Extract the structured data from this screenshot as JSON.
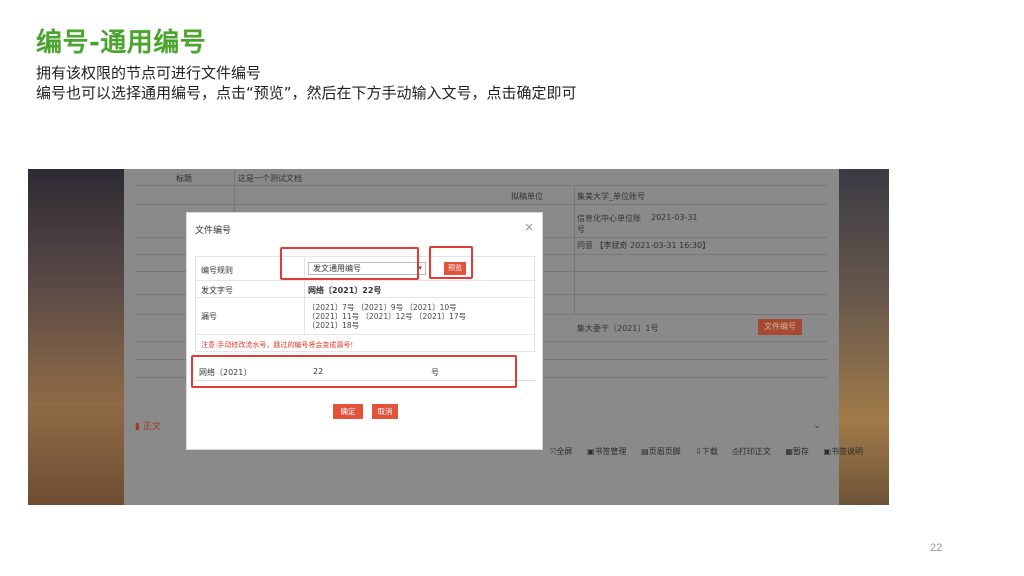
{
  "slide": {
    "title": "编号-通用编号",
    "line1": "拥有该权限的节点可进行文件编号",
    "line2": "编号也可以选择通用编号，点击“预览”，然后在下方手动输入文号，点击确定即可",
    "page_number": "22"
  },
  "background_form": {
    "title_label": "标题",
    "title_value": "这是一个测试文档",
    "draft_unit_label": "拟稿单位",
    "draft_unit_value": "集美大学_单位账号",
    "sign_label": "签",
    "info_center": "信息化中心单位账号",
    "info_date": "2021-03-31",
    "approve_label": "稿",
    "approve_value": "同意 【李斌奇  2021-03-31 16:30】",
    "receive_label": "集大委干〔2021〕1号",
    "file_number_btn": "文件编号",
    "zhengwen_label": "正文",
    "toolbar": [
      "全屏",
      "书签管理",
      "页眉页脚",
      "下载",
      "打印正文",
      "暂存",
      "书签说明"
    ]
  },
  "dialog": {
    "title": "文件编号",
    "close_glyph": "×",
    "rule_label": "编号规则",
    "rule_value": "发文通用编号",
    "preview_label": "预览",
    "docno_label": "发文字号",
    "docno_value": "网络〔2021〕22号",
    "missing_label": "漏号",
    "missing_lines": [
      "〔2021〕7号  〔2021〕9号  〔2021〕10号",
      "〔2021〕11号 〔2021〕12号 〔2021〕17号",
      "〔2021〕18号"
    ],
    "warning": "注意:手动修改流水号，跳过的编号将会变成漏号!",
    "prefix": "网络〔2021〕",
    "number_input": "22",
    "suffix": "号",
    "ok_label": "确定",
    "cancel_label": "取消"
  }
}
